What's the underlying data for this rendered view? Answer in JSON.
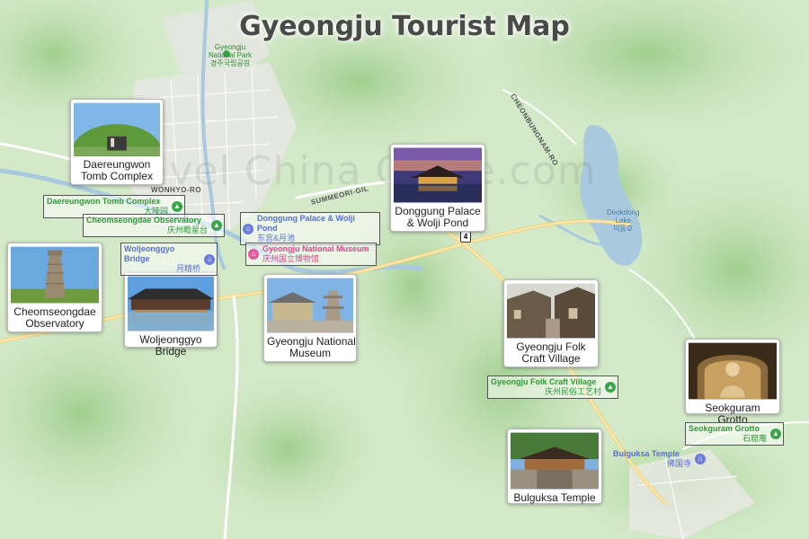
{
  "map": {
    "title": "Gyeongju Tourist Map",
    "watermark": "Travel China Guide.com"
  },
  "attractions": [
    {
      "name": "Daereungwon Tomb Complex",
      "caption": "Daereungwon\nTomb Complex",
      "label_en": "Daereungwon Tomb Complex",
      "label_cn": "大陵园",
      "category": "park",
      "color": "#2e9a35"
    },
    {
      "name": "Cheomseongdae Observatory",
      "caption": "Cheomseongdae\nObservatory",
      "label_en": "Cheomseongdae Observatory",
      "label_cn": "庆州瞻星台",
      "category": "park",
      "color": "#2e9a35"
    },
    {
      "name": "Woljeonggyo Bridge",
      "caption": "Woljeonggyo Bridge",
      "label_en": "Woljeonggyo Bridge",
      "label_cn": "月精桥",
      "category": "attraction",
      "color": "#5a6fd0"
    },
    {
      "name": "Donggung Palace & Wolji Pond",
      "caption": "Donggung Palace\n& Wolji Pond",
      "label_en": "Donggung Palace & Wolji Pond",
      "label_cn": "东宫&月池",
      "category": "attraction",
      "color": "#5a6fd0"
    },
    {
      "name": "Gyeongju National Museum",
      "caption": "Gyeongju National\nMuseum",
      "label_en": "Gyeongju National Museum",
      "label_cn": "庆州国立博物馆",
      "category": "museum",
      "color": "#d8468e"
    },
    {
      "name": "Gyeongju Folk Craft Village",
      "caption": "Gyeongju Folk\nCraft Village",
      "label_en": "Gyeongju Folk Craft Village",
      "label_cn": "庆州民俗工艺村",
      "category": "park",
      "color": "#2e9a35"
    },
    {
      "name": "Seokguram Grotto",
      "caption": "Seokguram Grotto",
      "label_en": "Seokguram Grotto",
      "label_cn": "石窟庵",
      "category": "park",
      "color": "#2e9a35"
    },
    {
      "name": "Bulguksa Temple",
      "caption": "Bulguksa Temple",
      "label_en": "Bulguksa Temple",
      "label_cn": "佛国寺",
      "category": "attraction",
      "color": "#5a6fd0"
    }
  ],
  "places": {
    "national_park_en": "Gyeongju\nNational Park",
    "national_park_kr": "경주국립공원",
    "lake_en": "Deokdong\nLake",
    "lake_kr": "덕동호"
  },
  "roads": {
    "wonhyo": "WONHYO-RO",
    "summeori": "SUMMEORI-GIL",
    "cheonbungnam": "CHEONBUNGNAM-RO",
    "route_shield": "4"
  },
  "icons": {
    "park": "park-icon",
    "attraction": "attraction-icon",
    "museum": "museum-icon"
  }
}
